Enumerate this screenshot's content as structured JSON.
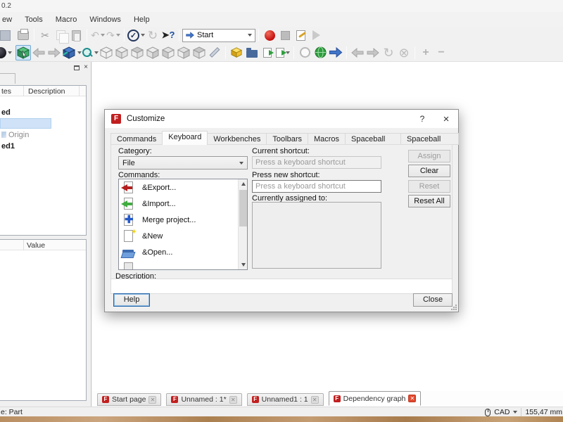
{
  "window": {
    "title_fragment": "0.2"
  },
  "menu": {
    "items": [
      "ew",
      "Tools",
      "Macro",
      "Windows",
      "Help"
    ]
  },
  "toolbar": {
    "workbench_value": "Start",
    "icons_row1": [
      "save-icon",
      "print-icon",
      "cut-icon",
      "copy-icon",
      "paste-icon",
      "undo-icon",
      "redo-icon",
      "macro-check-icon",
      "refresh-icon",
      "whats-this-icon",
      "workbench-selector",
      "record-macro-icon",
      "stop-macro-icon",
      "edit-macro-icon",
      "play-macro-icon"
    ],
    "icons_row2": [
      "draw-style-icon",
      "select-view-icon",
      "back-icon",
      "forward-icon",
      "set-view-icon",
      "zoom-icon",
      "axonometric-icon",
      "front-view-icon",
      "top-view-icon",
      "right-view-icon",
      "rear-view-icon",
      "bottom-view-icon",
      "left-view-icon",
      "measure-icon",
      "part-icon",
      "folder-icon",
      "export-icon",
      "export-dropdown-icon",
      "web-home-icon",
      "web-globe-icon",
      "web-forward-icon",
      "nav-back-icon",
      "nav-forward-icon",
      "nav-refresh-icon",
      "nav-stop-icon",
      "zoom-in-icon",
      "zoom-out-icon"
    ],
    "glyphs": {
      "scissors": "✂",
      "undo": "↶",
      "redo": "↷",
      "check": "✓",
      "whats_arrow": "➤",
      "refresh": "↻",
      "stop_circle": "⊗",
      "plus": "+",
      "minus": "−"
    }
  },
  "left_panel": {
    "dock_close_glyph": "×",
    "tree": {
      "columns": [
        "tes",
        "Description"
      ],
      "items": [
        {
          "label": "ed",
          "style": "bold"
        },
        {
          "label": "",
          "style": "selected"
        },
        {
          "label": "Origin",
          "style": "muted"
        },
        {
          "label": "ed1",
          "style": "bold"
        }
      ]
    },
    "property": {
      "value_column": "Value"
    }
  },
  "dialog": {
    "title": "Customize",
    "help_glyph": "?",
    "close_glyph": "×",
    "tabs": [
      "Commands",
      "Keyboard",
      "Workbenches",
      "Toolbars",
      "Macros",
      "Spaceball Motion",
      "Spaceball Buttons"
    ],
    "active_tab": "Keyboard",
    "category_label": "Category:",
    "category_value": "File",
    "commands_label": "Commands:",
    "commands": [
      {
        "label": "&Export...",
        "icon": "export-icon"
      },
      {
        "label": "&Import...",
        "icon": "import-icon"
      },
      {
        "label": "Merge project...",
        "icon": "merge-project-icon"
      },
      {
        "label": "&New",
        "icon": "new-document-icon"
      },
      {
        "label": "&Open...",
        "icon": "open-folder-icon"
      }
    ],
    "current_shortcut_label": "Current shortcut:",
    "current_shortcut_placeholder": "Press a keyboard shortcut",
    "new_shortcut_label": "Press new shortcut:",
    "new_shortcut_placeholder": "Press a keyboard shortcut",
    "assigned_label": "Currently assigned to:",
    "buttons": {
      "assign": "Assign",
      "clear": "Clear",
      "reset": "Reset",
      "reset_all": "Reset All",
      "help": "Help",
      "close": "Close"
    },
    "description_label": "Description:"
  },
  "mdi_tabs": [
    {
      "label": "Start page",
      "active": false
    },
    {
      "label": "Unnamed : 1*",
      "active": false
    },
    {
      "label": "Unnamed1 : 1",
      "active": false
    },
    {
      "label": "Dependency graph",
      "active": true
    }
  ],
  "status_bar": {
    "left": "e: Part",
    "nav_style": "CAD",
    "dimension": "155,47 mm"
  },
  "colors": {
    "accent": "#0078d7",
    "record_red": "#c40f0f",
    "active_tab_close": "#e0492f",
    "selection": "#cfe2f7",
    "desktop": "#b98f62"
  }
}
